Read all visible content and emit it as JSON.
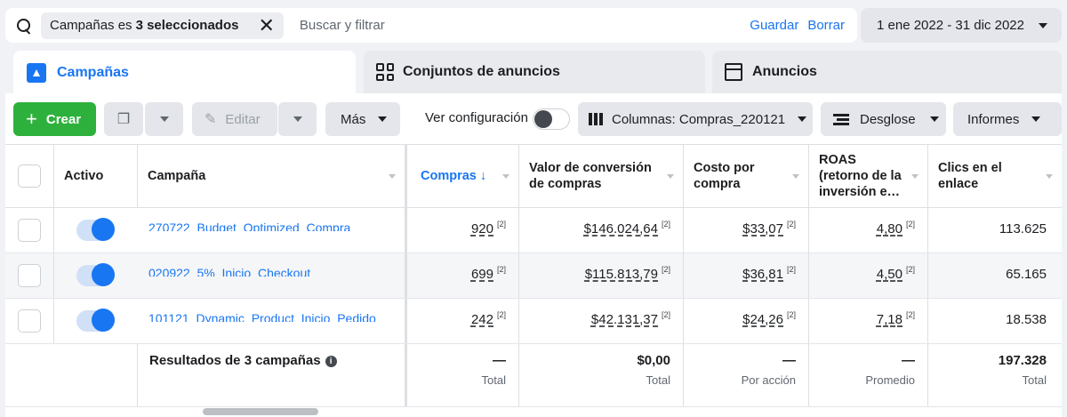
{
  "filter": {
    "chip_prefix": "Campañas es",
    "chip_bold": "3 seleccionados",
    "chip_close": "✕",
    "placeholder": "Buscar y filtrar",
    "save": "Guardar",
    "clear": "Borrar"
  },
  "date_range": "1 ene 2022 - 31 dic 2022",
  "tabs": [
    {
      "label": "Campañas",
      "active": true
    },
    {
      "label": "Conjuntos de anuncios",
      "active": false
    },
    {
      "label": "Anuncios",
      "active": false
    }
  ],
  "toolbar": {
    "create": "Crear",
    "edit": "Editar",
    "more": "Más",
    "show_config": "Ver configuración",
    "columns": "Columnas: Compras_220121",
    "breakdown": "Desglose",
    "reports": "Informes"
  },
  "columns": [
    "Activo",
    "Campaña",
    "Compras ↓",
    "Valor de conversión de compras",
    "Costo por compra",
    "ROAS (retorno de la inversión e…",
    "Clics en el enlace"
  ],
  "rows": [
    {
      "campaign": "270722_Budget_Optimized_Compra",
      "purchases": "920",
      "conv_value": "$146.024,64",
      "cost_per": "$33,07",
      "roas": "4,80",
      "clicks": "113.625",
      "note": "[2]"
    },
    {
      "campaign": "020922_5%_Inicio_Checkout",
      "purchases": "699",
      "conv_value": "$115.813,79",
      "cost_per": "$36,81",
      "roas": "4,50",
      "clicks": "65.165",
      "note": "[2]"
    },
    {
      "campaign": "101121_Dynamic_Product_Inicio_Pedido",
      "purchases": "242",
      "conv_value": "$42.131,37",
      "cost_per": "$24,26",
      "roas": "7,18",
      "clicks": "18.538",
      "note": "[2]"
    }
  ],
  "totals": {
    "label": "Resultados de 3 campañas",
    "info": "i",
    "purchases": "—",
    "purchases_sub": "Total",
    "conv_value": "$0,00",
    "conv_value_sub": "Total",
    "cost_per": "—",
    "cost_per_sub": "Por acción",
    "roas": "—",
    "roas_sub": "Promedio",
    "clicks": "197.328",
    "clicks_sub": "Total"
  },
  "colors": {
    "accent": "#1876f2",
    "create": "#2db13c"
  }
}
